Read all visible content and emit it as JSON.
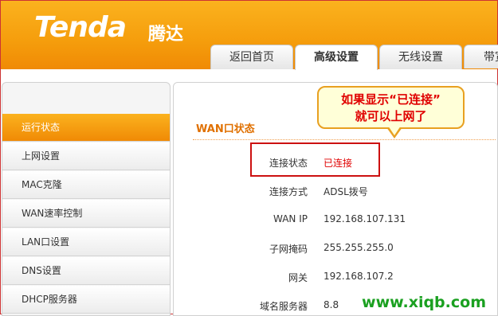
{
  "header": {
    "logo": "Tenda",
    "logo_cn": "腾达",
    "tabs": [
      {
        "label": "返回首页",
        "active": false
      },
      {
        "label": "高级设置",
        "active": true
      },
      {
        "label": "无线设置",
        "active": false
      },
      {
        "label": "带宽",
        "active": false
      }
    ]
  },
  "sidebar": {
    "items": [
      {
        "label": "运行状态",
        "active": true
      },
      {
        "label": "上网设置",
        "active": false
      },
      {
        "label": "MAC克隆",
        "active": false
      },
      {
        "label": "WAN速率控制",
        "active": false
      },
      {
        "label": "LAN口设置",
        "active": false
      },
      {
        "label": "DNS设置",
        "active": false
      },
      {
        "label": "DHCP服务器",
        "active": false
      }
    ]
  },
  "main": {
    "section_title": "WAN口状态",
    "rows": [
      {
        "label": "连接状态",
        "value": "已连接"
      },
      {
        "label": "连接方式",
        "value": "ADSL拨号"
      },
      {
        "label": "WAN IP",
        "value": "192.168.107.131"
      },
      {
        "label": "子网掩码",
        "value": "255.255.255.0"
      },
      {
        "label": "网关",
        "value": "192.168.107.2"
      },
      {
        "label": "域名服务器",
        "value": "8.8"
      }
    ]
  },
  "callout": {
    "line1": "如果显示“已连接”",
    "line2": "就可以上网了"
  },
  "watermark": "www.xiqb.com",
  "colors": {
    "accent": "#f59d0c",
    "status_connected": "#e00000",
    "highlight": "#cc1010"
  }
}
